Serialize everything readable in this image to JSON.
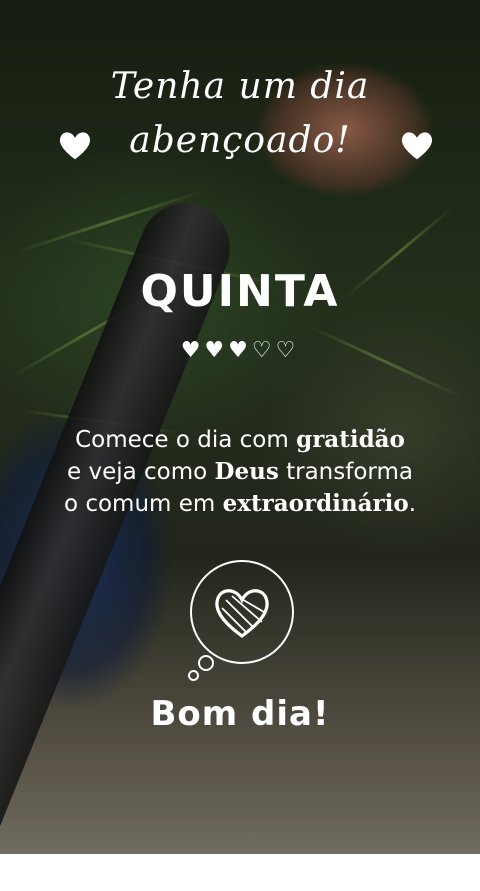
{
  "header": {
    "line1": "Tenha um dia",
    "line2": "abençoado!"
  },
  "day": {
    "name": "QUINTA",
    "hearts_filled": 3,
    "hearts_total": 5,
    "hearts": "♥♥♥♡♡"
  },
  "message": {
    "l1_a": "Comece o dia com ",
    "l1_b": "gratidão",
    "l2_a": "e veja como ",
    "l2_b": "Deus",
    "l2_c": " transforma",
    "l3_a": "o comum em ",
    "l3_b": "extraordinário",
    "l3_c": "."
  },
  "footer": {
    "greeting": "Bom dia!"
  },
  "icons": {
    "left_heart": "heart-icon",
    "right_heart": "heart-icon",
    "thought_heart": "heart-icon"
  },
  "colors": {
    "text": "#ffffff"
  }
}
